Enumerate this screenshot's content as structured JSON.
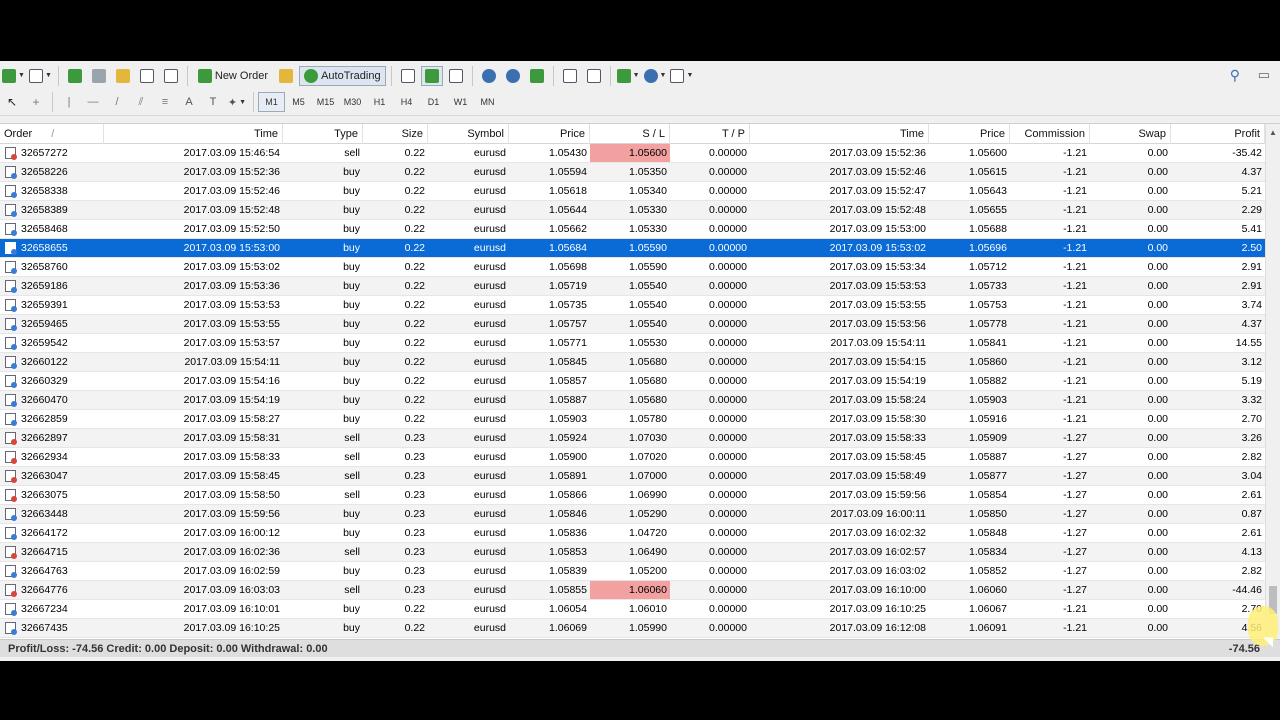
{
  "toolbar1": {
    "new_order_label": "New Order",
    "autotrading_label": "AutoTrading"
  },
  "toolbar2": {
    "timeframes": [
      "M1",
      "M5",
      "M15",
      "M30",
      "H1",
      "H4",
      "D1",
      "W1",
      "MN"
    ],
    "active_timeframe": "M1"
  },
  "columns": [
    "Order",
    "Time",
    "Type",
    "Size",
    "Symbol",
    "Price",
    "S / L",
    "T / P",
    "Time",
    "Price",
    "Commission",
    "Swap",
    "Profit"
  ],
  "order_sort_marker": "/",
  "rows": [
    [
      "32657272",
      "2017.03.09 15:46:54",
      "sell",
      "0.22",
      "eurusd",
      "1.05430",
      "1.05600",
      "0.00000",
      "2017.03.09 15:52:36",
      "1.05600",
      "-1.21",
      "0.00",
      "-35.42"
    ],
    [
      "32658226",
      "2017.03.09 15:52:36",
      "buy",
      "0.22",
      "eurusd",
      "1.05594",
      "1.05350",
      "0.00000",
      "2017.03.09 15:52:46",
      "1.05615",
      "-1.21",
      "0.00",
      "4.37"
    ],
    [
      "32658338",
      "2017.03.09 15:52:46",
      "buy",
      "0.22",
      "eurusd",
      "1.05618",
      "1.05340",
      "0.00000",
      "2017.03.09 15:52:47",
      "1.05643",
      "-1.21",
      "0.00",
      "5.21"
    ],
    [
      "32658389",
      "2017.03.09 15:52:48",
      "buy",
      "0.22",
      "eurusd",
      "1.05644",
      "1.05330",
      "0.00000",
      "2017.03.09 15:52:48",
      "1.05655",
      "-1.21",
      "0.00",
      "2.29"
    ],
    [
      "32658468",
      "2017.03.09 15:52:50",
      "buy",
      "0.22",
      "eurusd",
      "1.05662",
      "1.05330",
      "0.00000",
      "2017.03.09 15:53:00",
      "1.05688",
      "-1.21",
      "0.00",
      "5.41"
    ],
    [
      "32658655",
      "2017.03.09 15:53:00",
      "buy",
      "0.22",
      "eurusd",
      "1.05684",
      "1.05590",
      "0.00000",
      "2017.03.09 15:53:02",
      "1.05696",
      "-1.21",
      "0.00",
      "2.50"
    ],
    [
      "32658760",
      "2017.03.09 15:53:02",
      "buy",
      "0.22",
      "eurusd",
      "1.05698",
      "1.05590",
      "0.00000",
      "2017.03.09 15:53:34",
      "1.05712",
      "-1.21",
      "0.00",
      "2.91"
    ],
    [
      "32659186",
      "2017.03.09 15:53:36",
      "buy",
      "0.22",
      "eurusd",
      "1.05719",
      "1.05540",
      "0.00000",
      "2017.03.09 15:53:53",
      "1.05733",
      "-1.21",
      "0.00",
      "2.91"
    ],
    [
      "32659391",
      "2017.03.09 15:53:53",
      "buy",
      "0.22",
      "eurusd",
      "1.05735",
      "1.05540",
      "0.00000",
      "2017.03.09 15:53:55",
      "1.05753",
      "-1.21",
      "0.00",
      "3.74"
    ],
    [
      "32659465",
      "2017.03.09 15:53:55",
      "buy",
      "0.22",
      "eurusd",
      "1.05757",
      "1.05540",
      "0.00000",
      "2017.03.09 15:53:56",
      "1.05778",
      "-1.21",
      "0.00",
      "4.37"
    ],
    [
      "32659542",
      "2017.03.09 15:53:57",
      "buy",
      "0.22",
      "eurusd",
      "1.05771",
      "1.05530",
      "0.00000",
      "2017.03.09 15:54:11",
      "1.05841",
      "-1.21",
      "0.00",
      "14.55"
    ],
    [
      "32660122",
      "2017.03.09 15:54:11",
      "buy",
      "0.22",
      "eurusd",
      "1.05845",
      "1.05680",
      "0.00000",
      "2017.03.09 15:54:15",
      "1.05860",
      "-1.21",
      "0.00",
      "3.12"
    ],
    [
      "32660329",
      "2017.03.09 15:54:16",
      "buy",
      "0.22",
      "eurusd",
      "1.05857",
      "1.05680",
      "0.00000",
      "2017.03.09 15:54:19",
      "1.05882",
      "-1.21",
      "0.00",
      "5.19"
    ],
    [
      "32660470",
      "2017.03.09 15:54:19",
      "buy",
      "0.22",
      "eurusd",
      "1.05887",
      "1.05680",
      "0.00000",
      "2017.03.09 15:58:24",
      "1.05903",
      "-1.21",
      "0.00",
      "3.32"
    ],
    [
      "32662859",
      "2017.03.09 15:58:27",
      "buy",
      "0.22",
      "eurusd",
      "1.05903",
      "1.05780",
      "0.00000",
      "2017.03.09 15:58:30",
      "1.05916",
      "-1.21",
      "0.00",
      "2.70"
    ],
    [
      "32662897",
      "2017.03.09 15:58:31",
      "sell",
      "0.23",
      "eurusd",
      "1.05924",
      "1.07030",
      "0.00000",
      "2017.03.09 15:58:33",
      "1.05909",
      "-1.27",
      "0.00",
      "3.26"
    ],
    [
      "32662934",
      "2017.03.09 15:58:33",
      "sell",
      "0.23",
      "eurusd",
      "1.05900",
      "1.07020",
      "0.00000",
      "2017.03.09 15:58:45",
      "1.05887",
      "-1.27",
      "0.00",
      "2.82"
    ],
    [
      "32663047",
      "2017.03.09 15:58:45",
      "sell",
      "0.23",
      "eurusd",
      "1.05891",
      "1.07000",
      "0.00000",
      "2017.03.09 15:58:49",
      "1.05877",
      "-1.27",
      "0.00",
      "3.04"
    ],
    [
      "32663075",
      "2017.03.09 15:58:50",
      "sell",
      "0.23",
      "eurusd",
      "1.05866",
      "1.06990",
      "0.00000",
      "2017.03.09 15:59:56",
      "1.05854",
      "-1.27",
      "0.00",
      "2.61"
    ],
    [
      "32663448",
      "2017.03.09 15:59:56",
      "buy",
      "0.23",
      "eurusd",
      "1.05846",
      "1.05290",
      "0.00000",
      "2017.03.09 16:00:11",
      "1.05850",
      "-1.27",
      "0.00",
      "0.87"
    ],
    [
      "32664172",
      "2017.03.09 16:00:12",
      "buy",
      "0.23",
      "eurusd",
      "1.05836",
      "1.04720",
      "0.00000",
      "2017.03.09 16:02:32",
      "1.05848",
      "-1.27",
      "0.00",
      "2.61"
    ],
    [
      "32664715",
      "2017.03.09 16:02:36",
      "sell",
      "0.23",
      "eurusd",
      "1.05853",
      "1.06490",
      "0.00000",
      "2017.03.09 16:02:57",
      "1.05834",
      "-1.27",
      "0.00",
      "4.13"
    ],
    [
      "32664763",
      "2017.03.09 16:02:59",
      "buy",
      "0.23",
      "eurusd",
      "1.05839",
      "1.05200",
      "0.00000",
      "2017.03.09 16:03:02",
      "1.05852",
      "-1.27",
      "0.00",
      "2.82"
    ],
    [
      "32664776",
      "2017.03.09 16:03:03",
      "sell",
      "0.23",
      "eurusd",
      "1.05855",
      "1.06060",
      "0.00000",
      "2017.03.09 16:10:00",
      "1.06060",
      "-1.27",
      "0.00",
      "-44.46"
    ],
    [
      "32667234",
      "2017.03.09 16:10:01",
      "buy",
      "0.22",
      "eurusd",
      "1.06054",
      "1.06010",
      "0.00000",
      "2017.03.09 16:10:25",
      "1.06067",
      "-1.21",
      "0.00",
      "2.70"
    ],
    [
      "32667435",
      "2017.03.09 16:10:25",
      "buy",
      "0.22",
      "eurusd",
      "1.06069",
      "1.05990",
      "0.00000",
      "2017.03.09 16:12:08",
      "1.06091",
      "-1.21",
      "0.00",
      "4.56"
    ]
  ],
  "selected_row": 5,
  "sl_hit_rows": [
    0,
    23
  ],
  "summary": {
    "text": "Profit/Loss: -74.56  Credit: 0.00  Deposit: 0.00  Withdrawal: 0.00",
    "total": "-74.56"
  },
  "colors": {
    "selection": "#0a6ad6",
    "sl_hit": "#f2a0a0"
  }
}
